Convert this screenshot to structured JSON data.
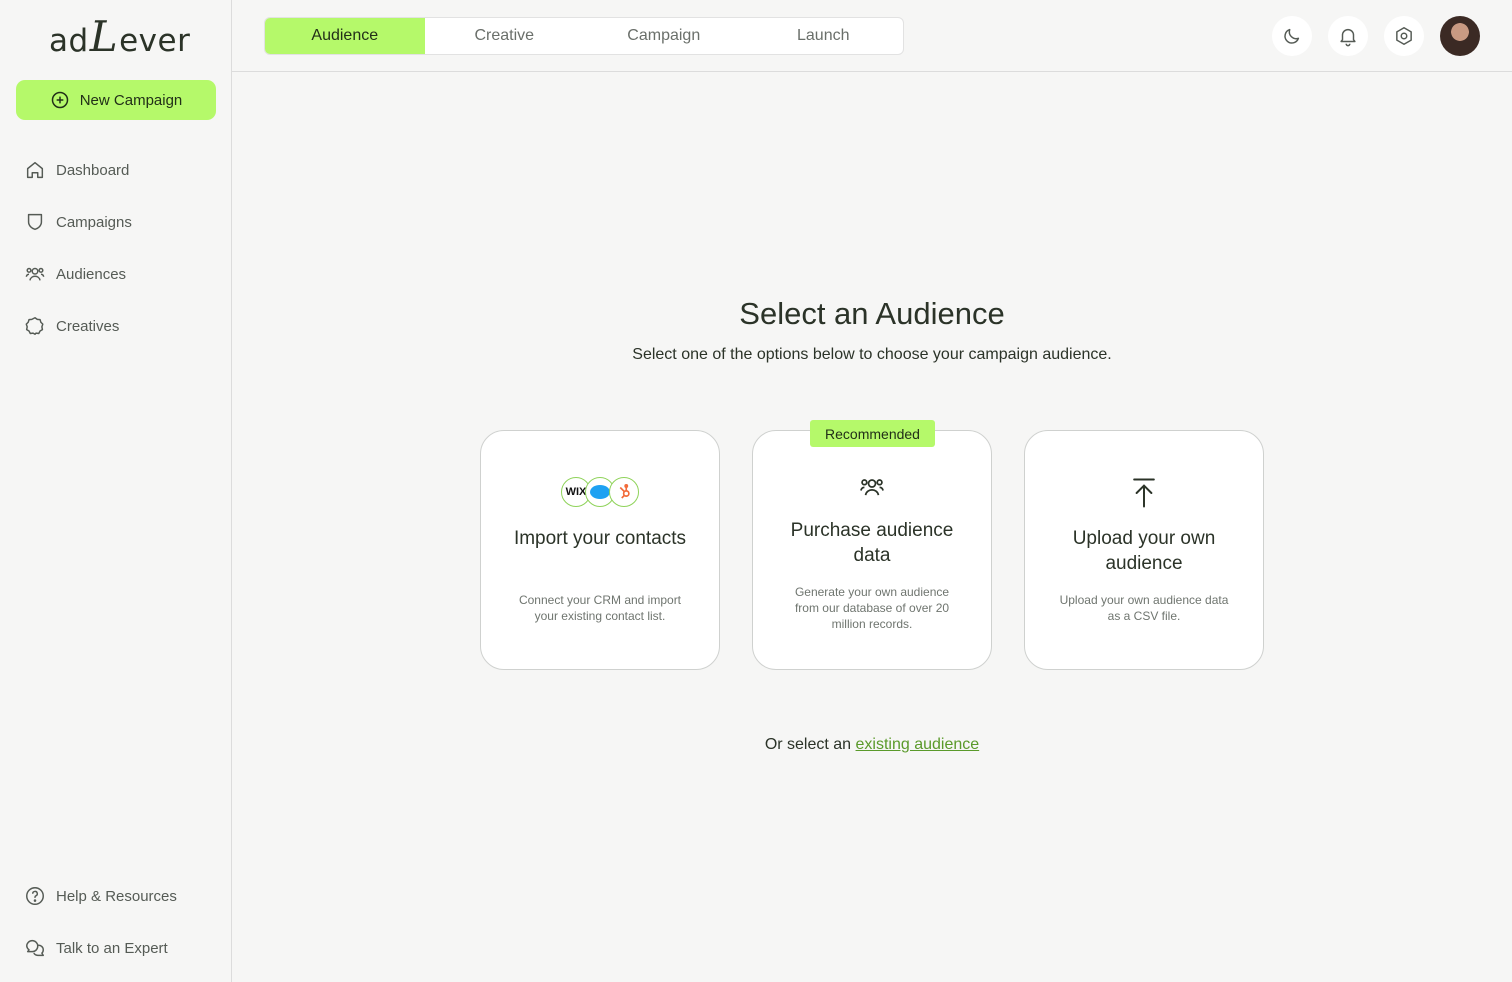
{
  "app": {
    "logo_prefix": "ad",
    "logo_letter": "L",
    "logo_suffix": "ever"
  },
  "sidebar": {
    "new_campaign_label": "New Campaign",
    "items": [
      {
        "label": "Dashboard",
        "icon": "home-icon"
      },
      {
        "label": "Campaigns",
        "icon": "shield-icon"
      },
      {
        "label": "Audiences",
        "icon": "users-icon"
      },
      {
        "label": "Creatives",
        "icon": "badge-icon"
      }
    ],
    "bottom_items": [
      {
        "label": "Help & Resources",
        "icon": "help-circle-icon"
      },
      {
        "label": "Talk to an Expert",
        "icon": "chat-bubbles-icon"
      }
    ]
  },
  "header": {
    "tabs": [
      {
        "label": "Audience",
        "active": true
      },
      {
        "label": "Creative",
        "active": false
      },
      {
        "label": "Campaign",
        "active": false
      },
      {
        "label": "Launch",
        "active": false
      }
    ],
    "icons": [
      "moon-icon",
      "bell-icon",
      "settings-icon",
      "avatar"
    ]
  },
  "main": {
    "title": "Select an Audience",
    "subtitle": "Select one of the options below to choose your campaign audience.",
    "badge": "Recommended",
    "crm_logo_wix": "WIX",
    "cards": [
      {
        "title": "Import your contacts",
        "description": "Connect your CRM and import your existing contact list.",
        "icon": "crm-logos-icon"
      },
      {
        "title": "Purchase audience data",
        "description": "Generate your own audience from our database of over 20 million records.",
        "icon": "users-icon"
      },
      {
        "title": "Upload your own audience",
        "description": "Upload your own audience data as a CSV file.",
        "icon": "upload-icon"
      }
    ],
    "footer_prefix": "Or select an",
    "footer_link": "existing audience"
  },
  "colors": {
    "accent": "#b5f96a",
    "link": "#5a9a2a",
    "background": "#f6f6f5"
  }
}
